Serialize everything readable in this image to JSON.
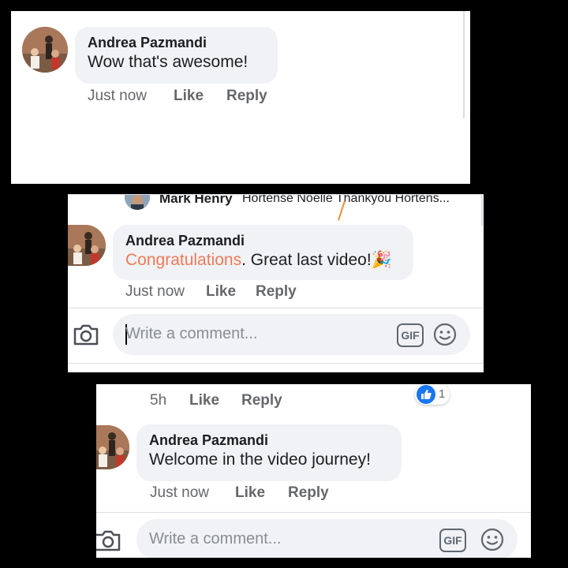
{
  "comment1": {
    "author": "Andrea Pazmandi",
    "text": "Wow that's awesome!",
    "time": "Just now",
    "like": "Like",
    "reply": "Reply"
  },
  "comment2": {
    "header_name": "Mark Henry",
    "header_text": "Hortense Noëlle Thankyou Hortens...",
    "author": "Andrea Pazmandi",
    "mention": "Congratulations",
    "text": ". Great last video!",
    "emoji": "🎉",
    "time": "Just now",
    "like": "Like",
    "reply": "Reply",
    "composer_placeholder": "Write a comment..."
  },
  "comment3": {
    "parent_time": "5h",
    "parent_like": "Like",
    "parent_reply": "Reply",
    "reaction_count": "1",
    "author": "Andrea Pazmandi",
    "text": "Welcome in the video journey!",
    "time": "Just now",
    "like": "Like",
    "reply": "Reply",
    "composer_placeholder": "Write a comment..."
  },
  "gif_label": "GIF",
  "colors": {
    "mention": "#ee7a57",
    "like_reaction": "#1877f2",
    "bubble": "#f0f2f5",
    "meta_text": "#65676b"
  }
}
